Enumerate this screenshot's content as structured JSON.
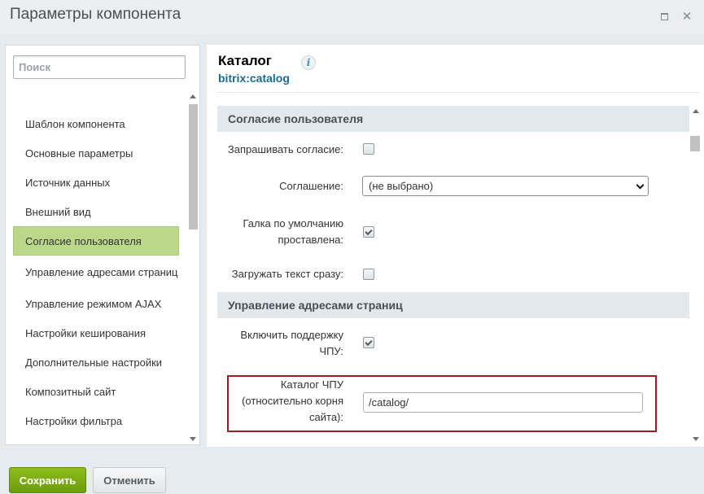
{
  "window": {
    "title": "Параметры компонента",
    "buttons": {
      "maximize_icon": "maximize-icon",
      "close_icon": "close-icon",
      "close_glyph": "✕"
    }
  },
  "sidebar": {
    "search_placeholder": "Поиск",
    "items": [
      {
        "label": "Шаблон компонента",
        "active": false
      },
      {
        "label": "Основные параметры",
        "active": false
      },
      {
        "label": "Источник данных",
        "active": false
      },
      {
        "label": "Внешний вид",
        "active": false
      },
      {
        "label": "Согласие пользователя",
        "active": true
      },
      {
        "label": "Управление адресами страниц",
        "active": false
      },
      {
        "label": "Управление режимом AJAX",
        "active": false
      },
      {
        "label": "Настройки кеширования",
        "active": false
      },
      {
        "label": "Дополнительные настройки",
        "active": false
      },
      {
        "label": "Композитный сайт",
        "active": false
      },
      {
        "label": "Настройки фильтра",
        "active": false
      }
    ]
  },
  "component": {
    "title": "Каталог",
    "code": "bitrix:catalog",
    "info_glyph": "i"
  },
  "sections": [
    {
      "header": "Согласие пользователя",
      "fields": {
        "request_consent": {
          "label": "Запрашивать согласие:",
          "checked": false
        },
        "agreement": {
          "label": "Соглашение:",
          "value": "(не выбрано)"
        },
        "default_checked": {
          "label": "Галка по умолчанию проставлена:",
          "checked": true
        },
        "load_text": {
          "label": "Загружать текст сразу:",
          "checked": false
        }
      }
    },
    {
      "header": "Управление адресами страниц",
      "fields": {
        "sef_mode": {
          "label": "Включить поддержку ЧПУ:",
          "checked": true
        },
        "sef_folder": {
          "label": "Каталог ЧПУ (относительно корня сайта):",
          "value": "/catalog/"
        }
      }
    }
  ],
  "footer": {
    "save_label": "Сохранить",
    "cancel_label": "Отменить"
  },
  "colors": {
    "accent_green": "#8ebd1c",
    "active_item": "#bad78a",
    "section_header": "#e1e9ef",
    "highlight_border": "#9a1f22",
    "link_blue": "#1a6b9a"
  }
}
